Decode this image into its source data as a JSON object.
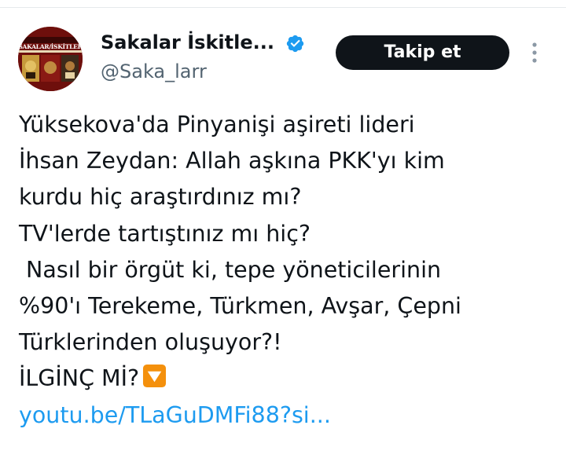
{
  "tweet": {
    "author": {
      "name": "Sakalar İskitle...",
      "handle": "@Saka_larr",
      "verified": true,
      "avatar_text": "SAKALAR/İSKİTLER"
    },
    "follow_button_label": "Takip et",
    "more_icon": "more-vertical-icon",
    "lines": [
      "Yüksekova'da Pinyanişi aşireti lideri",
      "İhsan Zeydan: Allah aşkına PKK'yı kim",
      "kurdu hiç araştırdınız mı?",
      "TV'lerde tartıştınız mı hiç?",
      " Nasıl bir örgüt ki, tepe yöneticilerinin",
      "%90'ı Terekeme, Türkmen, Avşar, Çepni",
      "Türklerinden oluşuyor?!",
      "İLGİNÇ Mİ?"
    ],
    "emoji": "down-button-emoji-icon",
    "link": "youtu.be/TLaGuDMFi88?si..."
  },
  "colors": {
    "text": "#0f1419",
    "secondary_text": "#536471",
    "verified_badge": "#1d9bf0",
    "link": "#1d9bf0",
    "follow_button_bg": "#0f1419",
    "follow_button_text": "#ffffff",
    "emoji_bg": "#f4900c"
  }
}
